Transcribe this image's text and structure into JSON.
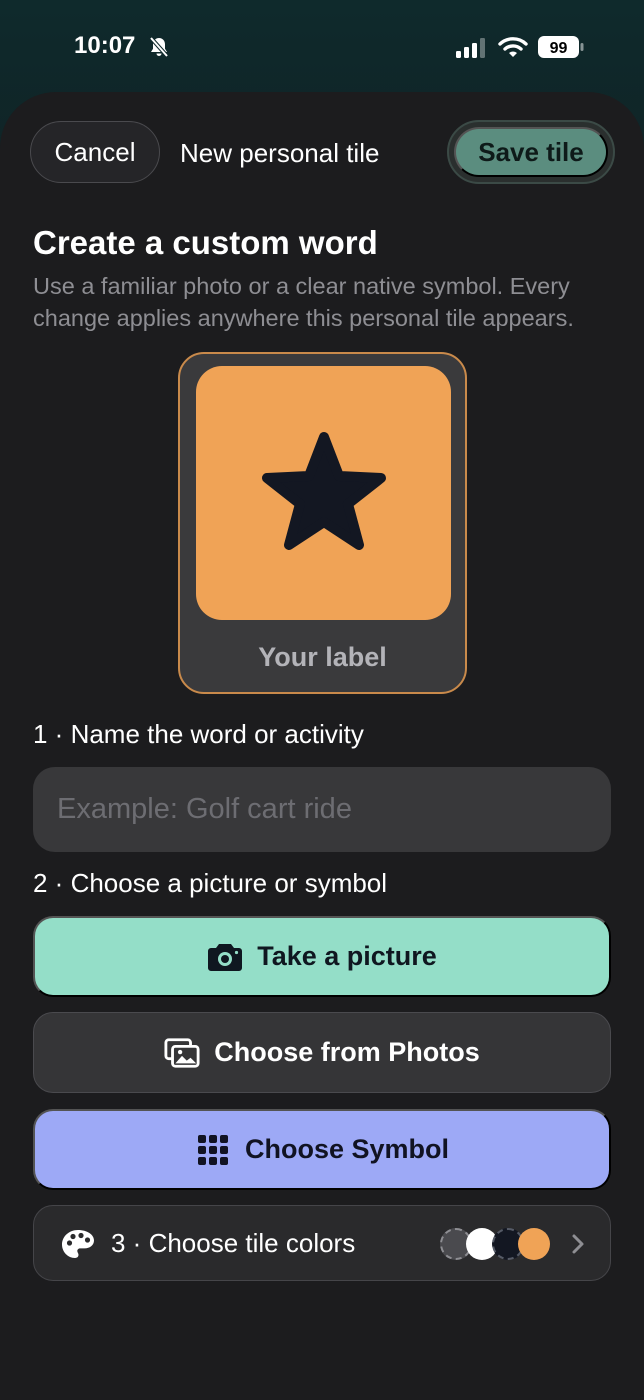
{
  "status": {
    "time": "10:07",
    "battery": "99"
  },
  "header": {
    "cancel_label": "Cancel",
    "title": "New personal tile",
    "save_label": "Save tile"
  },
  "intro": {
    "heading": "Create a custom word",
    "subtext": "Use a familiar photo or a clear native symbol. Every change applies anywhere this personal tile appears."
  },
  "preview": {
    "label": "Your label",
    "icon": "star-icon",
    "tile_color": "#f0a356",
    "border_color": "#c98a4b"
  },
  "step1": {
    "label": "1 · Name the word or activity",
    "input_placeholder": "Example: Golf cart ride",
    "input_value": ""
  },
  "step2": {
    "label": "2 · Choose a picture or symbol",
    "take_picture_label": "Take a picture",
    "choose_photos_label": "Choose from Photos",
    "choose_symbol_label": "Choose Symbol"
  },
  "step3": {
    "label": "3 · Choose tile colors",
    "swatches": [
      "#4a4a4e",
      "#ffffff",
      "#131722",
      "#f0a356"
    ]
  },
  "colors": {
    "accent_green": "#94dec8",
    "accent_violet": "#9da9f6",
    "save_green": "#5b8d7f"
  }
}
